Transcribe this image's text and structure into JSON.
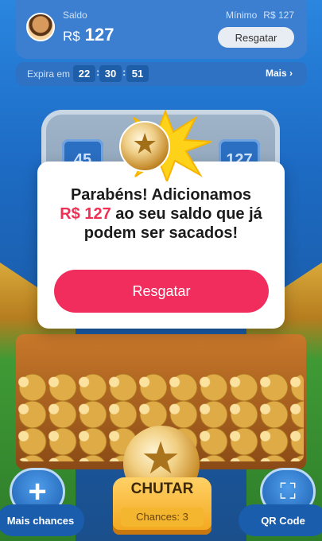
{
  "balance": {
    "label": "Saldo",
    "currency": "R$",
    "amount": "127",
    "minimum_label": "Mínimo",
    "minimum_value": "R$ 127",
    "redeem_button": "Resgatar"
  },
  "timer": {
    "label": "Expira em",
    "hours": "22",
    "minutes": "30",
    "seconds": "51",
    "more_label": "Mais ›"
  },
  "background_tiles": [
    "45",
    "127"
  ],
  "modal": {
    "line1": "Parabéns! Adicionamos",
    "amount": "R$ 127",
    "line2_rest": " ao seu saldo que já",
    "line3": "podem ser sacados!",
    "button": "Resgatar"
  },
  "controls": {
    "more_chances": "Mais chances",
    "qr_code": "QR Code",
    "kick": "CHUTAR",
    "chances": "Chances: 3"
  },
  "colors": {
    "accent": "#f02d5c",
    "primary": "#3c7fd0"
  }
}
